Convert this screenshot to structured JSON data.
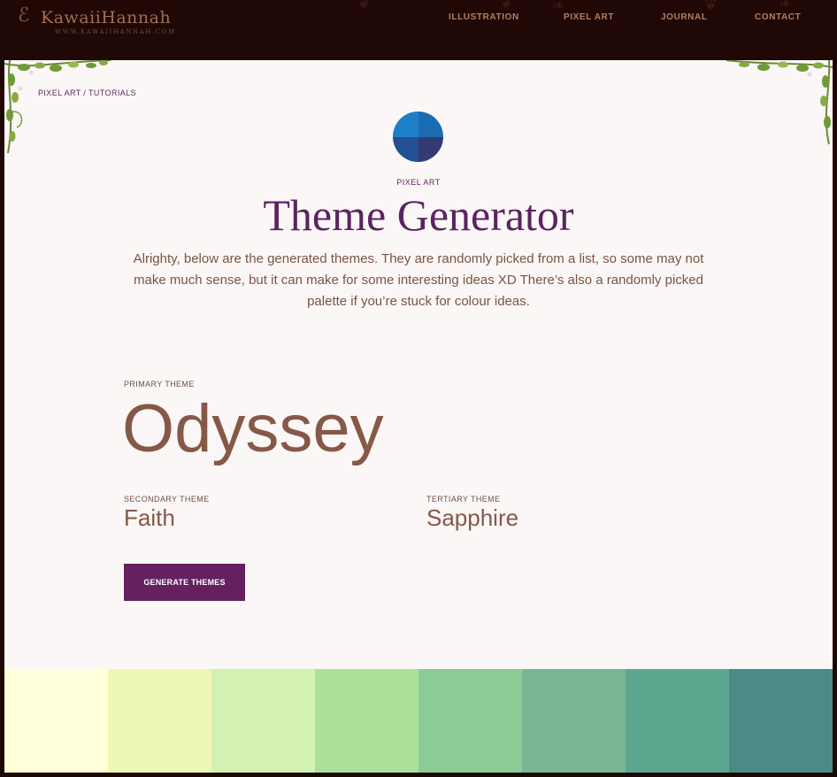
{
  "header": {
    "logo_name": "KawaiiHannah",
    "logo_sub": "WWW.KAWAIIHANNAH.COM",
    "nav": [
      {
        "label": "ILLUSTRATION"
      },
      {
        "label": "PIXEL ART"
      },
      {
        "label": "JOURNAL"
      },
      {
        "label": "CONTACT"
      }
    ]
  },
  "breadcrumb": {
    "parent": "PIXEL ART",
    "separator": " / ",
    "current": "TUTORIALS"
  },
  "post": {
    "category": "PIXEL ART",
    "title": "Theme Generator",
    "intro": "Alrighty, below are the generated themes. They are randomly picked from a list, so some may not make much sense, but it can make for some interesting ideas XD There’s also a randomly picked palette if you’re stuck for colour ideas."
  },
  "themes": {
    "primary_label": "PRIMARY THEME",
    "primary": "Odyssey",
    "secondary_label": "SECONDARY THEME",
    "secondary": "Faith",
    "tertiary_label": "TERTIARY THEME",
    "tertiary": "Sapphire"
  },
  "generate_button": "GENERATE THEMES",
  "colors": {
    "header_bg": "#200806",
    "accent_purple": "#652060",
    "title_purple": "#5c2361",
    "theme_brown": "#865848",
    "ball": [
      "#1c7fc7",
      "#1b6bb3",
      "#225092",
      "#333a74"
    ]
  },
  "palette": [
    {
      "color": "#ffffda"
    },
    {
      "color": "#eff7b7"
    },
    {
      "color": "#d3f1b1"
    },
    {
      "color": "#ace19c"
    },
    {
      "color": "#8dcb96"
    },
    {
      "color": "#79b693"
    },
    {
      "color": "#5ca690"
    },
    {
      "color": "#4a8b88"
    }
  ]
}
